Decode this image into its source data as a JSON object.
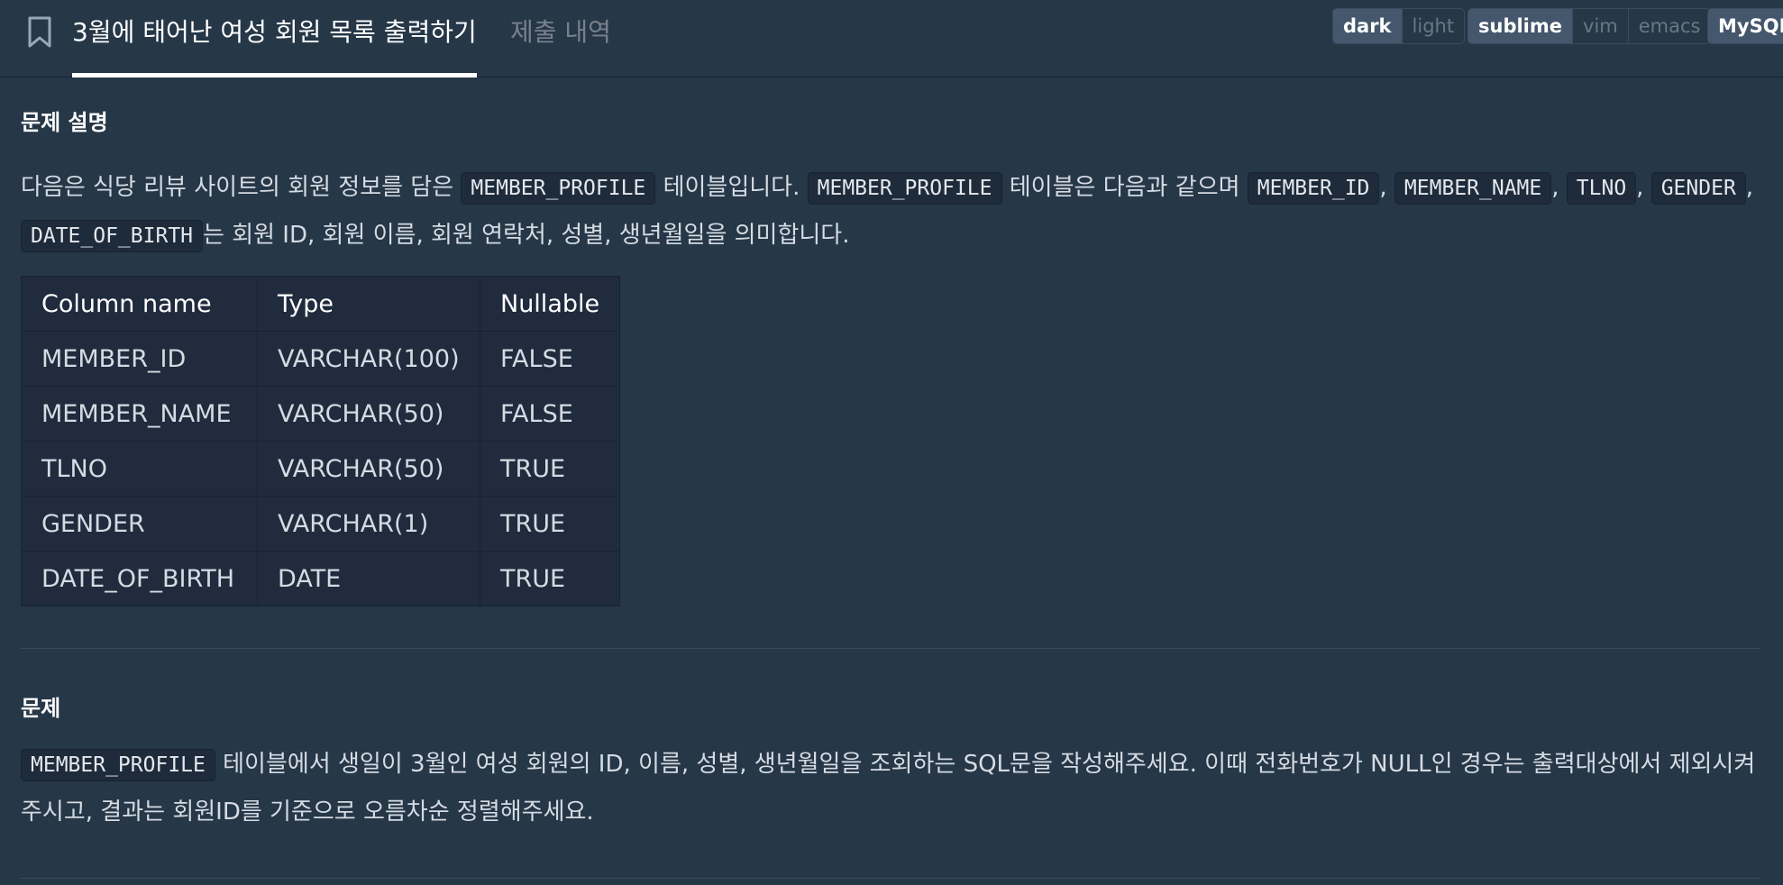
{
  "header": {
    "title": "3월에 태어난 여성 회원 목록 출력하기",
    "submission_tab": "제출 내역",
    "theme": {
      "dark": "dark",
      "light": "light",
      "selected": "dark"
    },
    "keymap": {
      "sublime": "sublime",
      "vim": "vim",
      "emacs": "emacs",
      "selected": "sublime"
    },
    "language": "MySQL"
  },
  "description": {
    "heading": "문제 설명",
    "p1": "다음은 식당 리뷰 사이트의 회원 정보를 담은",
    "code_member_profile": "MEMBER_PROFILE",
    "p2": "테이블입니다.",
    "p3": "테이블은 다음과 같으며",
    "code_member_id": "MEMBER_ID",
    "comma": ",",
    "code_member_name": "MEMBER_NAME",
    "code_tlno": "TLNO",
    "code_gender": "GENDER",
    "code_date_of_birth": "DATE_OF_BIRTH",
    "p4": "는 회원 ID, 회원 이름, 회원 연락처, 성별, 생년월일을 의미합니다."
  },
  "schema_table": {
    "headers": [
      "Column name",
      "Type",
      "Nullable"
    ],
    "rows": [
      [
        "MEMBER_ID",
        "VARCHAR(100)",
        "FALSE"
      ],
      [
        "MEMBER_NAME",
        "VARCHAR(50)",
        "FALSE"
      ],
      [
        "TLNO",
        "VARCHAR(50)",
        "TRUE"
      ],
      [
        "GENDER",
        "VARCHAR(1)",
        "TRUE"
      ],
      [
        "DATE_OF_BIRTH",
        "DATE",
        "TRUE"
      ]
    ]
  },
  "problem": {
    "heading": "문제",
    "code_member_profile": "MEMBER_PROFILE",
    "text": "테이블에서 생일이 3월인 여성 회원의 ID, 이름, 성별, 생년월일을 조회하는 SQL문을 작성해주세요. 이때 전화번호가 NULL인 경우는 출력대상에서 제외시켜 주시고, 결과는 회원ID를 기준으로 오름차순 정렬해주세요."
  },
  "colors": {
    "background": "#263747",
    "code_bg": "#1e2b3a",
    "table_bg": "#202b3d",
    "active_button": "#44576c"
  }
}
